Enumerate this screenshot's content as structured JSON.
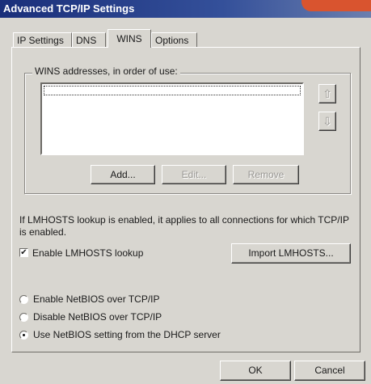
{
  "window": {
    "title": "Advanced TCP/IP Settings"
  },
  "tabs": [
    {
      "label": "IP Settings",
      "active": false
    },
    {
      "label": "DNS",
      "active": false
    },
    {
      "label": "WINS",
      "active": true
    },
    {
      "label": "Options",
      "active": false
    }
  ],
  "wins": {
    "group_label": "WINS addresses, in order of use:",
    "addresses": [],
    "up_icon": "arrow-up-icon",
    "down_icon": "arrow-down-icon",
    "add_label": "Add...",
    "edit_label": "Edit...",
    "remove_label": "Remove"
  },
  "lmhosts": {
    "info_text": "If LMHOSTS lookup is enabled, it applies to all connections for which TCP/IP is enabled.",
    "enable_label": "Enable LMHOSTS lookup",
    "enable_checked": true,
    "import_label": "Import LMHOSTS..."
  },
  "netbios": {
    "options": [
      {
        "label": "Enable NetBIOS over TCP/IP",
        "selected": false
      },
      {
        "label": "Disable NetBIOS over TCP/IP",
        "selected": false
      },
      {
        "label": "Use NetBIOS setting from the DHCP server",
        "selected": true
      }
    ]
  },
  "footer": {
    "ok_label": "OK",
    "cancel_label": "Cancel"
  },
  "colors": {
    "title_bar": "#1a2f7a",
    "corner_badge": "#d9542f"
  }
}
